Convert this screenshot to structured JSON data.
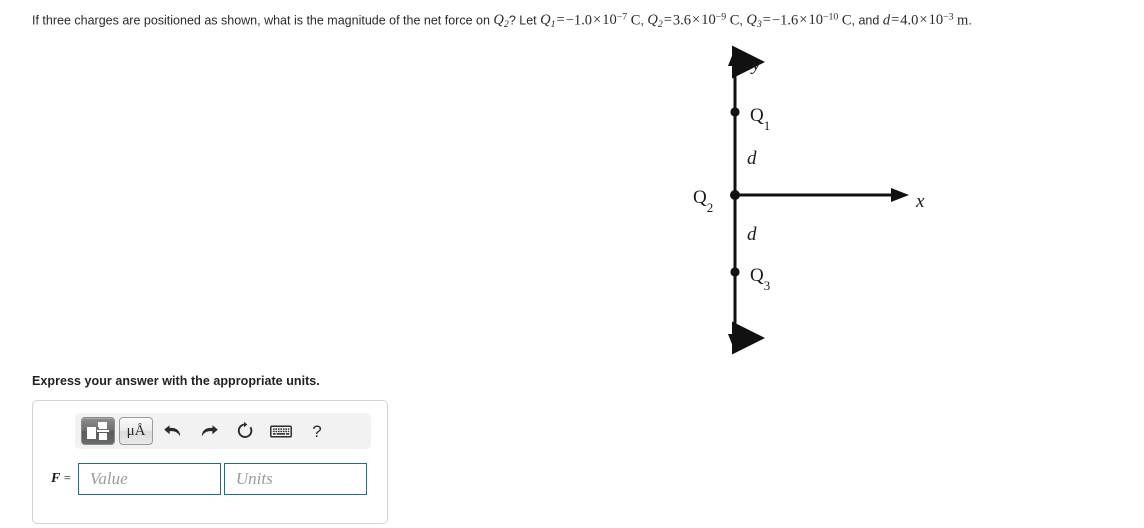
{
  "question": {
    "lead": "If three charges are positioned as shown, what is the magnitude of the net force on",
    "target_charge": "Q",
    "target_charge_sub": "2",
    "question_mark": "?",
    "let_word": "Let",
    "givens": [
      {
        "symbol": "Q",
        "sub": "1",
        "equals": "=",
        "mantissa": "−1.0",
        "times": "×",
        "base": "10",
        "exponent": "−7",
        "unit": "C",
        "trailing": ","
      },
      {
        "symbol": "Q",
        "sub": "2",
        "equals": "=",
        "mantissa": "3.6",
        "times": "×",
        "base": "10",
        "exponent": "−9",
        "unit": "C",
        "trailing": ","
      },
      {
        "symbol": "Q",
        "sub": "3",
        "equals": "=",
        "mantissa": "−1.6",
        "times": "×",
        "base": "10",
        "exponent": "−10",
        "unit": "C",
        "trailing": ","
      }
    ],
    "and_word": "and",
    "distance": {
      "symbol": "d",
      "equals": "=",
      "mantissa": "4.0",
      "times": "×",
      "base": "10",
      "exponent": "−3",
      "unit": "m",
      "trailing": "."
    }
  },
  "figure": {
    "name": "three-charge-diagram",
    "axis_y_label": "y",
    "axis_x_label": "x",
    "charge_top_label": "Q",
    "charge_top_sub": "1",
    "charge_origin_label": "Q",
    "charge_origin_sub": "2",
    "charge_bottom_label": "Q",
    "charge_bottom_sub": "3",
    "distance_upper_label": "d",
    "distance_lower_label": "d",
    "stroke_color": "#111111"
  },
  "express_prompt": "Express your answer with the appropriate units.",
  "toolbar": {
    "template_button_label": "math-template",
    "units_button_label": "μÅ",
    "undo_label": "undo",
    "redo_label": "redo",
    "reset_label": "reset",
    "keyboard_label": "keyboard",
    "help_label": "?"
  },
  "answer": {
    "variable": "F",
    "equals": "=",
    "value_placeholder": "Value",
    "value_text": "",
    "units_placeholder": "Units",
    "units_text": "",
    "border_color": "#1d6e86"
  }
}
